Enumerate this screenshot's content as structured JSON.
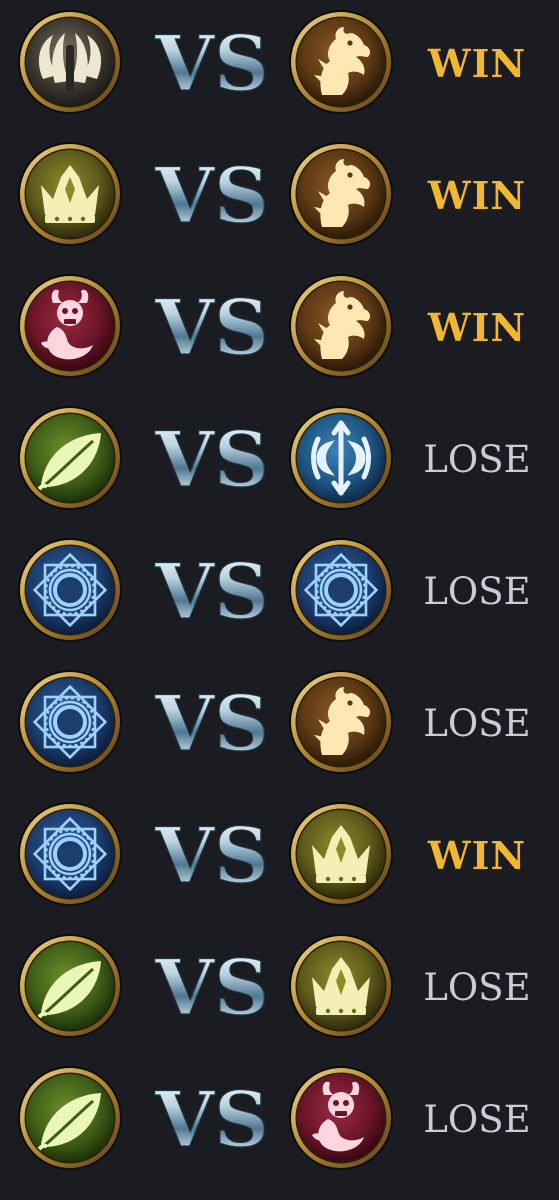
{
  "colors": {
    "background": "#1b1c21",
    "win": "#f2b731",
    "lose": "#c9ccd3",
    "ring_gold": "#c9a24a",
    "ring_dark": "#3b2d14"
  },
  "vs_label": "VS",
  "matchups": [
    {
      "left": "claws-icon",
      "right": "dragon-icon",
      "result": "WIN"
    },
    {
      "left": "crown-icon",
      "right": "dragon-icon",
      "result": "WIN"
    },
    {
      "left": "demon-icon",
      "right": "dragon-icon",
      "result": "WIN"
    },
    {
      "left": "leaf-icon",
      "right": "spirit-icon",
      "result": "LOSE"
    },
    {
      "left": "mandala-icon",
      "right": "mandala-icon",
      "result": "LOSE"
    },
    {
      "left": "mandala-icon",
      "right": "dragon-icon",
      "result": "LOSE"
    },
    {
      "left": "mandala-icon",
      "right": "crown-icon",
      "result": "WIN"
    },
    {
      "left": "leaf-icon",
      "right": "crown-icon",
      "result": "LOSE"
    },
    {
      "left": "leaf-icon",
      "right": "demon-icon",
      "result": "LOSE"
    }
  ]
}
